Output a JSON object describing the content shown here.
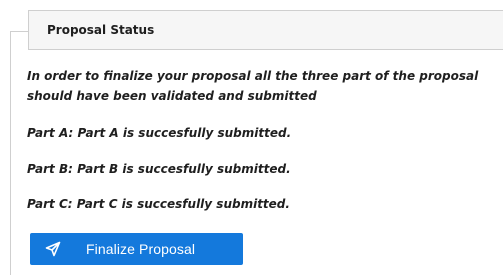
{
  "panel": {
    "title": "Proposal Status",
    "intro": "In order to finalize your proposal all the three part of the proposal should have been validated and submitted",
    "parts": [
      {
        "text": "Part A: Part A is succesfully submitted."
      },
      {
        "text": "Part B: Part B is succesfully submitted."
      },
      {
        "text": "Part C: Part C is succesfully submitted."
      }
    ],
    "finalize_button": {
      "label": "Finalize Proposal",
      "icon": "send-icon",
      "color": "#1479dc"
    }
  }
}
